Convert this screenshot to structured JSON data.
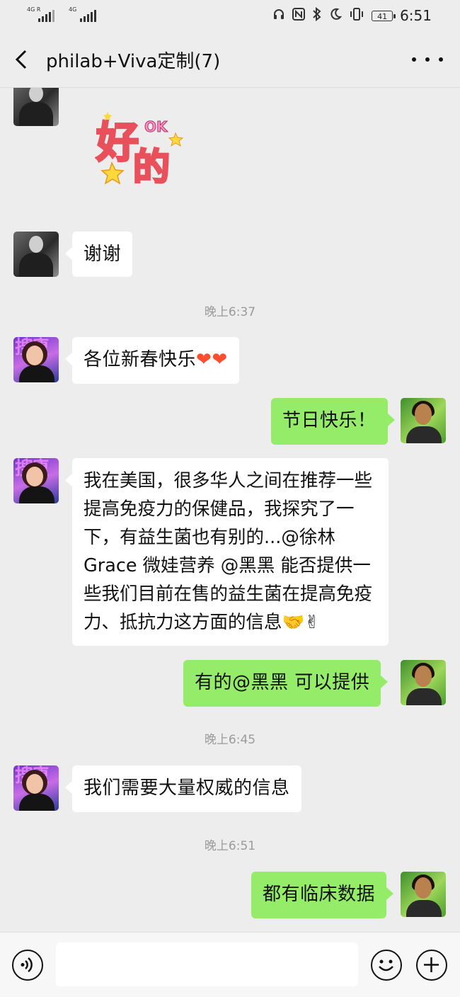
{
  "status_bar": {
    "net1": "4G R",
    "net2": "4G",
    "battery": "41",
    "time": "6:51"
  },
  "header": {
    "title": "philab+Viva定制(7)"
  },
  "sticker": {
    "big1": "好",
    "big2": "的",
    "small": "OK"
  },
  "messages": {
    "m1": "谢谢",
    "t1": "晚上6:37",
    "m2": "各位新春快乐",
    "m3": "节日快乐！",
    "m4": "我在美国，很多华人之间在推荐一些提高免疫力的保健品，我探究了一下，有益生菌也有别的...@徐林Grace 微娃营养 @黑黑  能否提供一些我们目前在售的益生菌在提高免疫力、抵抗力这方面的信息🤝✌",
    "m5": "有的@黑黑  可以提供",
    "t2": "晚上6:45",
    "m6": "我们需要大量权威的信息",
    "t3": "晚上6:51",
    "m7": "都有临床数据"
  },
  "avatar_text": {
    "m_bg": "搜瘦"
  },
  "emoji": {
    "heart": "❤",
    "handshake": "🤝",
    "victory": "✌"
  },
  "icons": [
    "back-arrow-icon",
    "more-icon",
    "voice-icon",
    "emoji-icon",
    "plus-icon"
  ],
  "colors": {
    "outgoing_bubble": "#95ec69",
    "incoming_bubble": "#ffffff",
    "background": "#ededed"
  }
}
